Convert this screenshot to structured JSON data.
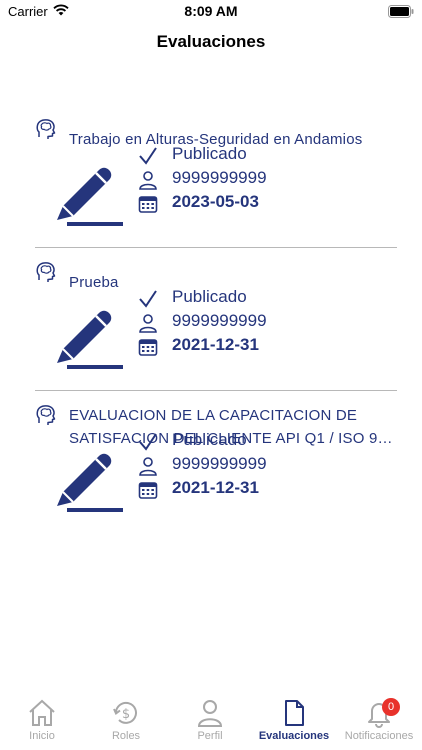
{
  "status_bar": {
    "carrier": "Carrier",
    "time": "8:09 AM"
  },
  "nav": {
    "title": "Evaluaciones"
  },
  "colors": {
    "accent": "#25357c",
    "divider": "#b8b8b8",
    "badge": "#e8322b",
    "inactive": "#a8a8a8"
  },
  "evaluations": [
    {
      "title": "Trabajo en Alturas-Seguridad en Andamios",
      "status": "Publicado",
      "user": "9999999999",
      "date": "2023-05-03"
    },
    {
      "title": "Prueba",
      "status": "Publicado",
      "user": "9999999999",
      "date": "2021-12-31"
    },
    {
      "title": "EVALUACION DE LA CAPACITACION DE SATISFACION DEL CLIENTE API Q1 / ISO 9…",
      "status": "Publicado",
      "user": "9999999999",
      "date": "2021-12-31"
    }
  ],
  "tabs": [
    {
      "label": "Inicio",
      "icon": "home-icon"
    },
    {
      "label": "Roles",
      "icon": "dollar-refresh-icon"
    },
    {
      "label": "Perfil",
      "icon": "person-icon"
    },
    {
      "label": "Evaluaciones",
      "icon": "document-icon",
      "active": true
    },
    {
      "label": "Notificaciones",
      "icon": "bell-icon",
      "badge": "0"
    }
  ]
}
